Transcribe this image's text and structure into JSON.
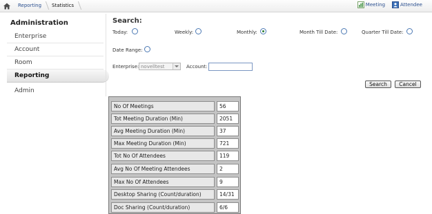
{
  "breadcrumb": {
    "items": [
      "Reporting",
      "Statistics"
    ]
  },
  "toplinks": {
    "meeting": "Meeting",
    "attendee": "Attendee"
  },
  "sidebar": {
    "title": "Administration",
    "items": [
      {
        "label": "Enterprise"
      },
      {
        "label": "Account"
      },
      {
        "label": "Room"
      },
      {
        "label": "Reporting",
        "active": true
      },
      {
        "label": "Admin"
      }
    ]
  },
  "search": {
    "heading": "Search:",
    "periods": {
      "today": "Today:",
      "weekly": "Weekly:",
      "monthly": "Monthly:",
      "month_till_date": "Month Till Date:",
      "quarter_till_date": "Quarter Till Date:",
      "date_range": "Date Range:"
    },
    "selected_period": "monthly",
    "enterprise_label": "Enterprise:",
    "enterprise_value": "novelltest",
    "account_label": "Account:",
    "account_value": "",
    "search_button": "Search",
    "cancel_button": "Cancel"
  },
  "stats": [
    {
      "label": "No Of Meetings",
      "value": "56"
    },
    {
      "label": "Tot Meeting Duration (Min)",
      "value": "2051"
    },
    {
      "label": "Avg Meeting Duration (Min)",
      "value": "37"
    },
    {
      "label": "Max Meeting Duration (Min)",
      "value": "721"
    },
    {
      "label": "Tot No Of Attendees",
      "value": "119"
    },
    {
      "label": "Avg No Of Meeting Attendees",
      "value": "2"
    },
    {
      "label": "Max No Of Attendees",
      "value": "9"
    },
    {
      "label": "Desktop Sharing (Count/duration)",
      "value": "14/31"
    },
    {
      "label": "Doc Sharing (Count/duration)",
      "value": "6/6"
    }
  ]
}
